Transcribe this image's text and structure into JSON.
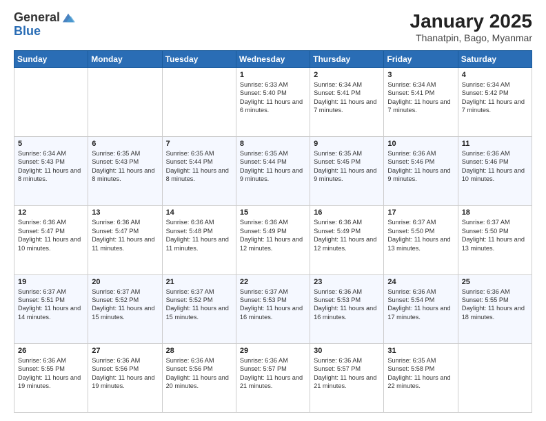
{
  "logo": {
    "line1": "General",
    "line2": "Blue"
  },
  "title": "January 2025",
  "location": "Thanatpin, Bago, Myanmar",
  "days_of_week": [
    "Sunday",
    "Monday",
    "Tuesday",
    "Wednesday",
    "Thursday",
    "Friday",
    "Saturday"
  ],
  "weeks": [
    [
      {
        "num": "",
        "text": ""
      },
      {
        "num": "",
        "text": ""
      },
      {
        "num": "",
        "text": ""
      },
      {
        "num": "1",
        "text": "Sunrise: 6:33 AM\nSunset: 5:40 PM\nDaylight: 11 hours and 6 minutes."
      },
      {
        "num": "2",
        "text": "Sunrise: 6:34 AM\nSunset: 5:41 PM\nDaylight: 11 hours and 7 minutes."
      },
      {
        "num": "3",
        "text": "Sunrise: 6:34 AM\nSunset: 5:41 PM\nDaylight: 11 hours and 7 minutes."
      },
      {
        "num": "4",
        "text": "Sunrise: 6:34 AM\nSunset: 5:42 PM\nDaylight: 11 hours and 7 minutes."
      }
    ],
    [
      {
        "num": "5",
        "text": "Sunrise: 6:34 AM\nSunset: 5:43 PM\nDaylight: 11 hours and 8 minutes."
      },
      {
        "num": "6",
        "text": "Sunrise: 6:35 AM\nSunset: 5:43 PM\nDaylight: 11 hours and 8 minutes."
      },
      {
        "num": "7",
        "text": "Sunrise: 6:35 AM\nSunset: 5:44 PM\nDaylight: 11 hours and 8 minutes."
      },
      {
        "num": "8",
        "text": "Sunrise: 6:35 AM\nSunset: 5:44 PM\nDaylight: 11 hours and 9 minutes."
      },
      {
        "num": "9",
        "text": "Sunrise: 6:35 AM\nSunset: 5:45 PM\nDaylight: 11 hours and 9 minutes."
      },
      {
        "num": "10",
        "text": "Sunrise: 6:36 AM\nSunset: 5:46 PM\nDaylight: 11 hours and 9 minutes."
      },
      {
        "num": "11",
        "text": "Sunrise: 6:36 AM\nSunset: 5:46 PM\nDaylight: 11 hours and 10 minutes."
      }
    ],
    [
      {
        "num": "12",
        "text": "Sunrise: 6:36 AM\nSunset: 5:47 PM\nDaylight: 11 hours and 10 minutes."
      },
      {
        "num": "13",
        "text": "Sunrise: 6:36 AM\nSunset: 5:47 PM\nDaylight: 11 hours and 11 minutes."
      },
      {
        "num": "14",
        "text": "Sunrise: 6:36 AM\nSunset: 5:48 PM\nDaylight: 11 hours and 11 minutes."
      },
      {
        "num": "15",
        "text": "Sunrise: 6:36 AM\nSunset: 5:49 PM\nDaylight: 11 hours and 12 minutes."
      },
      {
        "num": "16",
        "text": "Sunrise: 6:36 AM\nSunset: 5:49 PM\nDaylight: 11 hours and 12 minutes."
      },
      {
        "num": "17",
        "text": "Sunrise: 6:37 AM\nSunset: 5:50 PM\nDaylight: 11 hours and 13 minutes."
      },
      {
        "num": "18",
        "text": "Sunrise: 6:37 AM\nSunset: 5:50 PM\nDaylight: 11 hours and 13 minutes."
      }
    ],
    [
      {
        "num": "19",
        "text": "Sunrise: 6:37 AM\nSunset: 5:51 PM\nDaylight: 11 hours and 14 minutes."
      },
      {
        "num": "20",
        "text": "Sunrise: 6:37 AM\nSunset: 5:52 PM\nDaylight: 11 hours and 15 minutes."
      },
      {
        "num": "21",
        "text": "Sunrise: 6:37 AM\nSunset: 5:52 PM\nDaylight: 11 hours and 15 minutes."
      },
      {
        "num": "22",
        "text": "Sunrise: 6:37 AM\nSunset: 5:53 PM\nDaylight: 11 hours and 16 minutes."
      },
      {
        "num": "23",
        "text": "Sunrise: 6:36 AM\nSunset: 5:53 PM\nDaylight: 11 hours and 16 minutes."
      },
      {
        "num": "24",
        "text": "Sunrise: 6:36 AM\nSunset: 5:54 PM\nDaylight: 11 hours and 17 minutes."
      },
      {
        "num": "25",
        "text": "Sunrise: 6:36 AM\nSunset: 5:55 PM\nDaylight: 11 hours and 18 minutes."
      }
    ],
    [
      {
        "num": "26",
        "text": "Sunrise: 6:36 AM\nSunset: 5:55 PM\nDaylight: 11 hours and 19 minutes."
      },
      {
        "num": "27",
        "text": "Sunrise: 6:36 AM\nSunset: 5:56 PM\nDaylight: 11 hours and 19 minutes."
      },
      {
        "num": "28",
        "text": "Sunrise: 6:36 AM\nSunset: 5:56 PM\nDaylight: 11 hours and 20 minutes."
      },
      {
        "num": "29",
        "text": "Sunrise: 6:36 AM\nSunset: 5:57 PM\nDaylight: 11 hours and 21 minutes."
      },
      {
        "num": "30",
        "text": "Sunrise: 6:36 AM\nSunset: 5:57 PM\nDaylight: 11 hours and 21 minutes."
      },
      {
        "num": "31",
        "text": "Sunrise: 6:35 AM\nSunset: 5:58 PM\nDaylight: 11 hours and 22 minutes."
      },
      {
        "num": "",
        "text": ""
      }
    ]
  ]
}
